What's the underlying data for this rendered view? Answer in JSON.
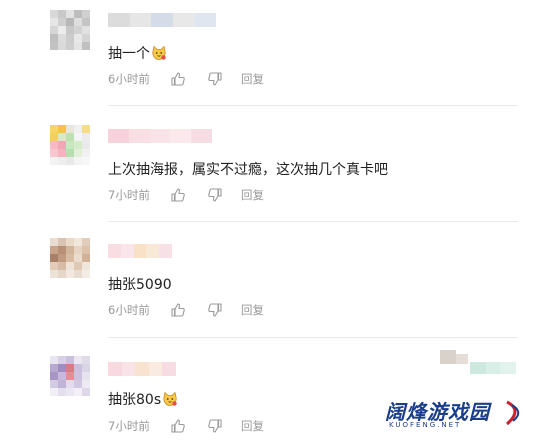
{
  "comments": [
    {
      "text": "抽一个",
      "has_emoji": true,
      "time": "6小时前",
      "reply_label": "回复",
      "avatar_colors": [
        "#d8d8d8",
        "#c9c9c9",
        "#e3e3e3",
        "#bdbdbd",
        "#d0d0d0",
        "#e6e6e6",
        "#cfcfcf",
        "#b8b8b8",
        "#dedede",
        "#c4c4c4",
        "#d6d6d6",
        "#ececec",
        "#c7c7c7",
        "#d2d2d2",
        "#e1e1e1",
        "#bfbfbf",
        "#dcdcdc",
        "#cbcbcb",
        "#e8e8e8",
        "#d4d4d4",
        "#c2c2c2",
        "#dadada",
        "#cdcdcd",
        "#e4e4e4",
        "#c0c0c0"
      ],
      "name_colors": [
        "#dcdcdc",
        "#e6e6e6",
        "#d4dce8",
        "#e8e8e8",
        "#dfe6f0"
      ]
    },
    {
      "text": "上次抽海报，属实不过瘾，这次抽几个真卡吧",
      "has_emoji": false,
      "time": "7小时前",
      "reply_label": "回复",
      "avatar_colors": [
        "#f6d36b",
        "#f3c24f",
        "#e8e6e0",
        "#f0f0f0",
        "#f7dd8a",
        "#f2cf63",
        "#d9e8c8",
        "#bfe0b0",
        "#f4f4f4",
        "#ececec",
        "#f8b9c4",
        "#f3a7b6",
        "#c9e6bf",
        "#d5ecc9",
        "#eaeaea",
        "#f7c6cf",
        "#f5b2bf",
        "#b7dcae",
        "#e2f0da",
        "#f1f1f1",
        "#f2f2f2",
        "#eeeeee",
        "#e9e9e9",
        "#f4f4f4",
        "#f7f7f7"
      ],
      "name_colors": [
        "#f7d2da",
        "#f9dfe4",
        "#f8e4e8",
        "#fbe9ec",
        "#f6dde3"
      ]
    },
    {
      "text": "抽张5090",
      "has_emoji": false,
      "time": "6小时前",
      "reply_label": "回复",
      "avatar_colors": [
        "#e9ddd2",
        "#d8c4b2",
        "#ead9c6",
        "#f2e7db",
        "#e0cdbb",
        "#c8a48a",
        "#b98f76",
        "#d2b39b",
        "#e6d3c1",
        "#dcc3ad",
        "#a97f6a",
        "#c19a82",
        "#d8bba3",
        "#ebdccd",
        "#cfb29a",
        "#e2ccb9",
        "#d6bca6",
        "#efe3d7",
        "#dfc9b5",
        "#f0e6dc",
        "#ece2d8",
        "#e5d6c8",
        "#f1e8df",
        "#e8dbcf",
        "#f4ede6"
      ],
      "name_colors": [
        "#f8dde3",
        "#fae6ea",
        "#f9e1c8",
        "#f8e8d8",
        "#f7e0e6"
      ]
    },
    {
      "text": "抽张80s",
      "has_emoji": true,
      "time": "7小时前",
      "reply_label": "回复",
      "avatar_colors": [
        "#e8e4f0",
        "#d8d0e6",
        "#c9c1dd",
        "#ebe6f2",
        "#e0dbe9",
        "#b6a9cf",
        "#9f8cc0",
        "#d97a86",
        "#c9c1dc",
        "#dad4e7",
        "#a795c6",
        "#c6b9dc",
        "#e58d95",
        "#cdc3e0",
        "#e7e2ee",
        "#d3cbe3",
        "#bfb3d6",
        "#e2dcec",
        "#d0c8e1",
        "#eeeaf4",
        "#f1eef6",
        "#e4dfed",
        "#ebe7f2",
        "#f3f0f7",
        "#ddd7e9"
      ],
      "name_colors": [
        "#f8d9df",
        "#fae3e7",
        "#f8e2d0",
        "#f9ebe0",
        "#f7dde3"
      ]
    }
  ],
  "stray_name_colors": [
    "#d9d2cb",
    "#e5ded8",
    "#cde9df",
    "#d8efe7",
    "#e2f3ed"
  ],
  "watermark": {
    "title": "阔烽游戏园",
    "subtitle": "KUOFENG.NET"
  }
}
